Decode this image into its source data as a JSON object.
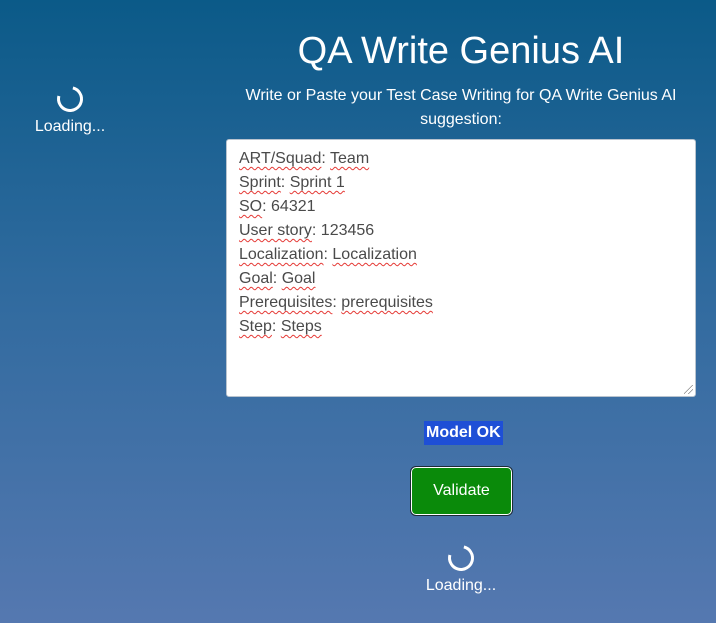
{
  "app": {
    "title": "QA Write Genius AI",
    "subtitle": "Write or Paste your Test Case Writing for QA Write Genius AI suggestion:"
  },
  "editor": {
    "lines": [
      {
        "label": "ART/Squad",
        "value": "Team"
      },
      {
        "label": "Sprint",
        "value": "Sprint 1"
      },
      {
        "label": "SO",
        "value": "64321"
      },
      {
        "label": "User story",
        "value": "123456"
      },
      {
        "label": "Localization",
        "value": "Localization"
      },
      {
        "label": "Goal",
        "value": "Goal"
      },
      {
        "label": "Prerequisites",
        "value": "prerequisites"
      },
      {
        "label": "Step",
        "value": "Steps"
      }
    ]
  },
  "status": {
    "text": "Model OK",
    "color": "#1e4fd6"
  },
  "actions": {
    "validate_label": "Validate",
    "validate_color": "#0a8a0a"
  },
  "loaders": {
    "left_text": "Loading...",
    "bottom_text": "Loading..."
  }
}
